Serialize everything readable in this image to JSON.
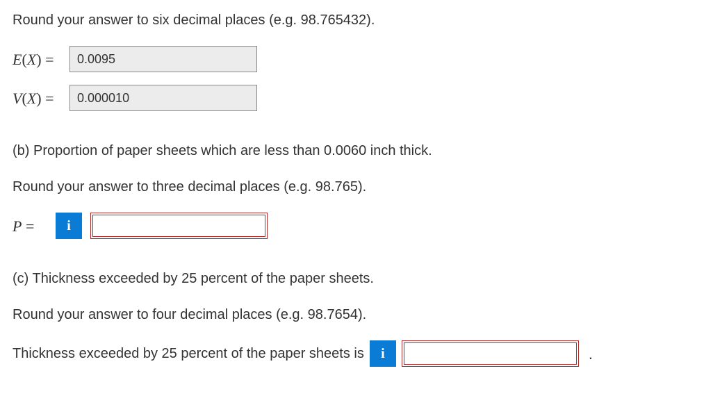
{
  "section_a": {
    "instruction": "Round your answer to six decimal places (e.g. 98.765432).",
    "ex_label_var": "E",
    "vx_label_var": "V",
    "label_x": "X",
    "eq": " = ",
    "ex_value": "0.0095",
    "vx_value": "0.000010"
  },
  "section_b": {
    "prompt": "(b) Proportion of paper sheets which are less than 0.0060 inch thick.",
    "instruction": "Round your answer to three decimal places (e.g. 98.765).",
    "p_label": "P",
    "eq": " = ",
    "info_icon": "i",
    "value": ""
  },
  "section_c": {
    "prompt": "(c) Thickness exceeded by 25 percent of the paper sheets.",
    "instruction": "Round your answer to four decimal places (e.g. 98.7654).",
    "lead_text": "Thickness exceeded by 25 percent of the paper sheets is",
    "info_icon": "i",
    "value": "",
    "period": "."
  }
}
